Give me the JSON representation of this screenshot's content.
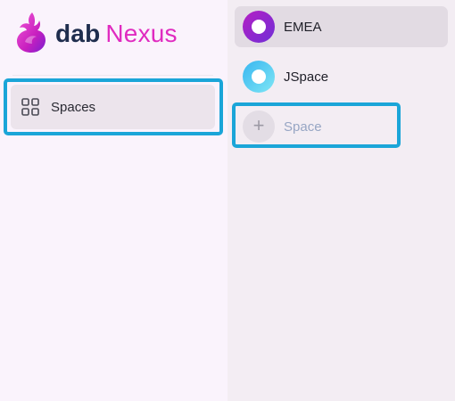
{
  "brand": {
    "name_part1": "dab",
    "name_part2": "Nexus",
    "logo_icon": "phoenix-logo-icon",
    "colors": {
      "dark": "#1f2d4e",
      "accent": "#e02bc0"
    }
  },
  "sidebar": {
    "items": [
      {
        "label": "Spaces",
        "icon": "grid-icon",
        "selected": true
      }
    ]
  },
  "spaces_panel": {
    "items": [
      {
        "label": "EMEA",
        "active": true,
        "gradient": [
          "#b51fc4",
          "#6f2fd6"
        ]
      },
      {
        "label": "JSpace",
        "active": false,
        "gradient": [
          "#38b6f0",
          "#7fe6f5"
        ]
      }
    ],
    "add": {
      "label": "Space",
      "icon": "plus-icon",
      "symbol": "+"
    }
  },
  "highlight_color": "#1aa5d8"
}
